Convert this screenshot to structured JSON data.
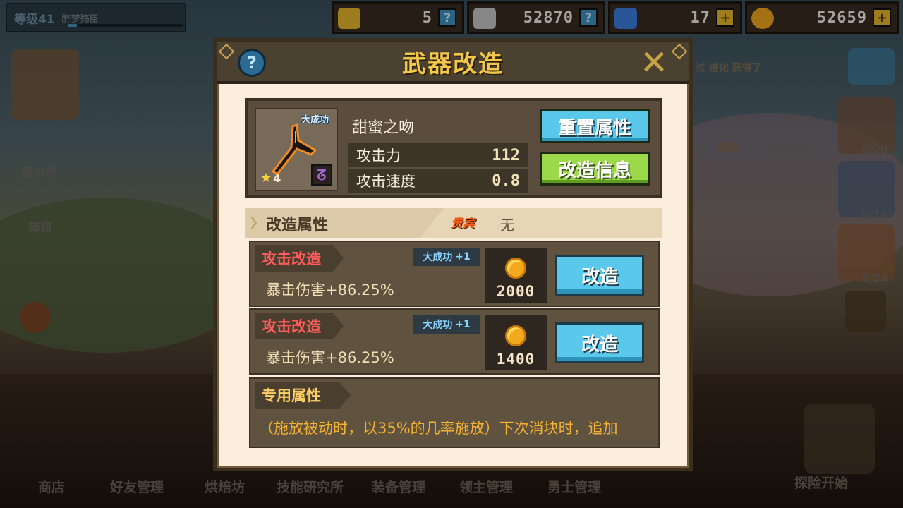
{
  "topbar": {
    "level_label": "等级41",
    "player_name": "醉梦殇臣",
    "resources": [
      {
        "name": "hammer",
        "icon": "hammer-icon",
        "value": "5",
        "action": "?"
      },
      {
        "name": "ore",
        "icon": "ore-icon",
        "value": "52870",
        "action": "?"
      },
      {
        "name": "gem",
        "icon": "gem-icon",
        "value": "17",
        "action": "+"
      },
      {
        "name": "gold",
        "icon": "gold-coin-icon",
        "value": "52659",
        "action": "+"
      }
    ]
  },
  "background": {
    "left_labels": [
      "图书馆",
      "邮箱"
    ],
    "right_labels": [
      "活动",
      "限量商品!"
    ],
    "right_counts": [
      "0/20",
      "0/18",
      "0/24"
    ],
    "marquee": "过 进化 获得了",
    "bottom_nav": [
      "商店",
      "好友管理",
      "烘焙坊",
      "技能研究所",
      "装备管理",
      "领主管理",
      "勇士管理"
    ],
    "start_label": "探险开始"
  },
  "modal": {
    "title": "武器改造",
    "help": "?",
    "close": "✕",
    "weapon": {
      "name": "甜蜜之吻",
      "badge": "大成功",
      "stars": "4",
      "stats": [
        {
          "key": "攻击力",
          "value": "112"
        },
        {
          "key": "攻击速度",
          "value": "0.8"
        }
      ],
      "reset_label": "重置属性",
      "info_label": "改造信息"
    },
    "refine": {
      "title": "改造属性",
      "vip_label": "贵宾",
      "vip_value": "无",
      "rows": [
        {
          "type": "攻击改造",
          "effect": "暴击伤害+86.25%",
          "great": "大成功",
          "great_bonus": "+1",
          "cost": "2000",
          "button": "改造"
        },
        {
          "type": "攻击改造",
          "effect": "暴击伤害+86.25%",
          "great": "大成功",
          "great_bonus": "+1",
          "cost": "1400",
          "button": "改造"
        }
      ]
    },
    "special": {
      "title": "专用属性",
      "text": "（施放被动时，以35%的几率施放）下次消块时，追加"
    }
  },
  "colors": {
    "accent_blue": "#59c8ea",
    "accent_green": "#9bd94a",
    "title_gold": "#f3c74a",
    "refine_red": "#ff5c5c"
  }
}
